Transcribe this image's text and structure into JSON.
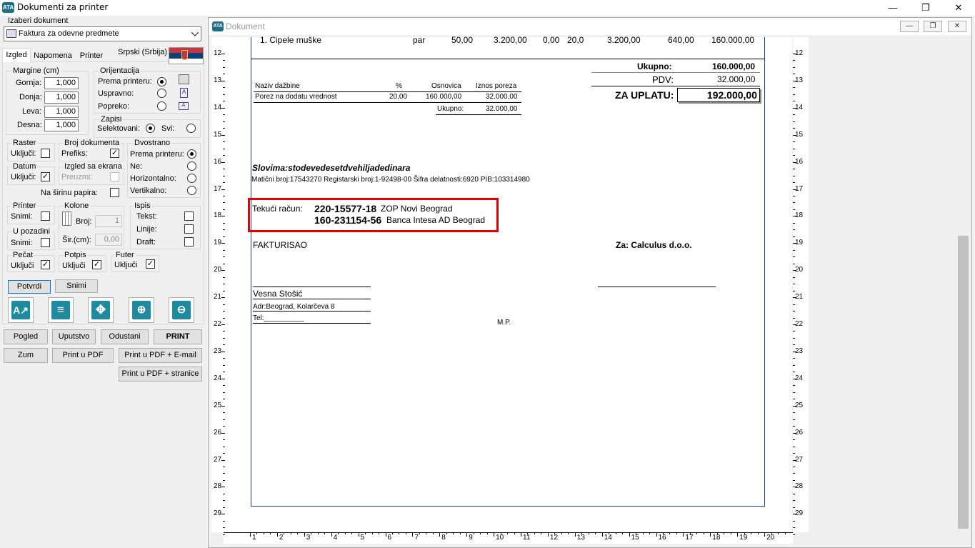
{
  "window": {
    "title": "Dokumenti za printer",
    "app_icon": "ATA",
    "min": "—",
    "max": "❐",
    "close": "✕"
  },
  "left": {
    "doc_label": "Izaberi dokument",
    "doc_value": "Faktura za odevne predmete",
    "tabs": [
      "Izgled",
      "Napomena",
      "Printer"
    ],
    "language": "Srpski (Srbija)",
    "margins": {
      "title": "Margine (cm)",
      "gornja": "Gornja:",
      "donja": "Donja:",
      "leva": "Leva:",
      "desna": "Desna:",
      "gornja_v": "1,000",
      "donja_v": "1,000",
      "leva_v": "1,000",
      "desna_v": "1,000"
    },
    "orient": {
      "title": "Orijentacija",
      "prema": "Prema printeru:",
      "uspravno": "Uspravno:",
      "popreko": "Popreko:"
    },
    "zapisi": {
      "title": "Zapisi",
      "selektovani": "Selektovani:",
      "svi": "Svi:"
    },
    "raster": {
      "title": "Raster",
      "ukljuci": "Uključi:"
    },
    "broj_dok": {
      "title": "Broj dokumenta",
      "prefiks": "Prefiks:"
    },
    "dvostrano": {
      "title": "Dvostrano",
      "prema": "Prema printeru:",
      "ne": "Ne:",
      "horizontalno": "Horizontalno:",
      "vertikalno": "Vertikalno:"
    },
    "datum": {
      "title": "Datum",
      "ukljuci": "Uključi:"
    },
    "izgled_ekrana": {
      "title": "Izgled sa ekrana",
      "preuzmi": "Preuzmi:"
    },
    "na_sirinu": "Na širinu papira:",
    "printer": {
      "title": "Printer",
      "snimi": "Snimi:"
    },
    "kolone": {
      "title": "Kolone",
      "broj": "Broj:",
      "broj_v": "1",
      "sir": "Šir.(cm):",
      "sir_v": "0,00"
    },
    "ispis": {
      "title": "Ispis",
      "tekst": "Tekst:",
      "linije": "Linije:",
      "draft": "Draft:"
    },
    "u_pozadini": {
      "title": "U pozadini",
      "snimi": "Snimi:"
    },
    "pecat": {
      "title": "Pečat",
      "ukljuci": "Uključi"
    },
    "potpis": {
      "title": "Potpis",
      "ukljuci": "Uključi"
    },
    "futer": {
      "title": "Futer",
      "ukljuci": "Uključi"
    },
    "btn_potvrdi": "Potvrdi",
    "btn_snimi": "Snimi",
    "btn_pogled": "Pogled",
    "btn_uputstvo": "Uputstvo",
    "btn_odustani": "Odustani",
    "btn_print": "PRINT",
    "btn_zum": "Zum",
    "btn_print_pdf": "Print u PDF",
    "btn_print_pdf_email": "Print u PDF  + E-mail",
    "btn_print_pdf_str": "Print u PDF  + stranice",
    "check": "✓"
  },
  "doc": {
    "title": "Dokument",
    "row": {
      "name": "1. Cipele muške",
      "unit": "par",
      "qty": "50,00",
      "price": "3.200,00",
      "disc": "0,00",
      "tax": "20,0",
      "base": "3.200,00",
      "vat": "640,00",
      "total": "160.000,00"
    },
    "tax_table": {
      "h_name": "Naziv dažbine",
      "h_pct": "%",
      "h_base": "Osnovica",
      "h_amt": "Iznos poreza",
      "name": "Porez na dodatu vrednost",
      "pct": "20,00",
      "base": "160.000,00",
      "amt": "32.000,00",
      "sum_label": "Ukupno:",
      "sum": "32.000,00"
    },
    "totals": {
      "ukupno_l": "Ukupno:",
      "ukupno": "160.000,00",
      "pdv_l": "PDV:",
      "pdv": "32.000,00",
      "za_uplatu_l": "ZA UPLATU:",
      "za_uplatu": "192.000,00"
    },
    "slovima": "Slovima:stodevedesetdvehiljadedinara",
    "maticni": "Matični broj:17543270 Registarski broj:1-92498-00 Šifra delatnosti:6920 PIB:103314980",
    "tekuci_label": "Tekući račun:",
    "acc1": "220-15577-18",
    "bank1": "ZOP Novi Beograd",
    "acc2": "160-231154-56",
    "bank2": "Banca Intesa AD Beograd",
    "fakturisao": "FAKTURISAO",
    "za_firmu": "Za: Calculus d.o.o.",
    "signer": "Vesna Stošić",
    "adr": "Adr:Beograd, Kolarčeva 8",
    "tel": "Tel:__________",
    "mp": "M.P."
  },
  "ruler": {
    "v": [
      "12",
      "13",
      "14",
      "15",
      "16",
      "17",
      "18",
      "19",
      "20",
      "21",
      "22",
      "23",
      "24",
      "25",
      "26",
      "27",
      "28",
      "29"
    ],
    "h": [
      "1",
      "2",
      "3",
      "4",
      "5",
      "6",
      "7",
      "8",
      "9",
      "10",
      "11",
      "12",
      "13",
      "14",
      "15",
      "16",
      "17",
      "18",
      "19",
      "20"
    ]
  },
  "colors": {
    "accent": "#1e8aa0",
    "highlight": "#e00000",
    "frame": "#1a3aa0"
  }
}
